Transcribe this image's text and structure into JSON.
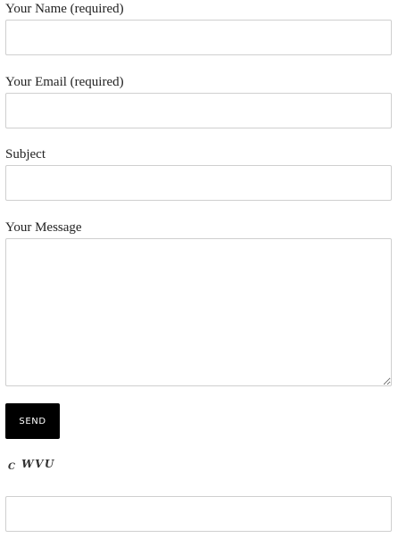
{
  "form": {
    "name_label": "Your Name (required)",
    "name_value": "",
    "email_label": "Your Email (required)",
    "email_value": "",
    "subject_label": "Subject",
    "subject_value": "",
    "message_label": "Your Message",
    "message_value": "",
    "send_label": "SEND",
    "captcha_first": "C",
    "captcha_rest": " WVU",
    "captcha_answer": ""
  }
}
